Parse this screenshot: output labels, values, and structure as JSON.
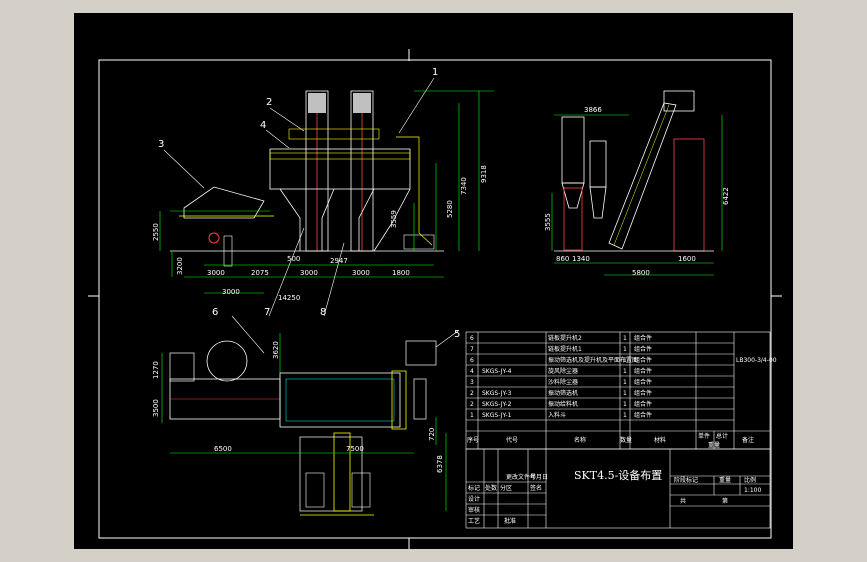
{
  "drawing": {
    "title": "SKT4.5-设备布置",
    "part_numbers": [
      "1",
      "2",
      "3",
      "4",
      "5",
      "6",
      "7",
      "8"
    ],
    "dims_elevation": [
      "3000",
      "2075",
      "500",
      "3000",
      "2947",
      "3000",
      "1800",
      "14250",
      "3000",
      "3200",
      "2550",
      "9318",
      "7340",
      "5280",
      "3559"
    ],
    "dims_side": [
      "3866",
      "6422",
      "3555",
      "860",
      "1340",
      "5800",
      "1600"
    ],
    "dims_plan": [
      "1270",
      "3500",
      "6500",
      "3620",
      "7500",
      "6378",
      "720"
    ]
  },
  "bom": {
    "rows": [
      {
        "no": "6",
        "code": "",
        "name": "链板提升机2",
        "qty": "1",
        "material": "组合件"
      },
      {
        "no": "7",
        "code": "",
        "name": "链板提升机1",
        "qty": "1",
        "material": "组合件"
      },
      {
        "no": "6",
        "code": "",
        "name": "振动筛选机及提升机及平面布置图",
        "qty": "1",
        "material": "组合件"
      },
      {
        "no": "4",
        "code": "SKGS-JY-4",
        "name": "旋风除尘器",
        "qty": "1",
        "material": "组合件"
      },
      {
        "no": "3",
        "code": "",
        "name": "沙料除尘器",
        "qty": "1",
        "material": "组合件"
      },
      {
        "no": "2",
        "code": "SKGS-JY-3",
        "name": "振动筛选机",
        "qty": "1",
        "material": "组合件"
      },
      {
        "no": "2",
        "code": "SKGS-JY-2",
        "name": "振动给料机",
        "qty": "1",
        "material": "组合件"
      },
      {
        "no": "1",
        "code": "SKGS-JY-1",
        "name": "入料斗",
        "qty": "1",
        "material": "组合件"
      }
    ],
    "header": {
      "no": "序号",
      "code": "代号",
      "name": "名称",
      "qty": "数量",
      "material": "材料",
      "unit_weight": "单件",
      "total_weight": "总计",
      "weight": "重量",
      "remark": "备注"
    },
    "side_code": "LB300-3/4-00"
  },
  "title_block": {
    "title": "SKT4.5-设备布置",
    "scale": "1:100",
    "stage_label": "阶段标记",
    "weight_label": "重量",
    "ratio_label": "比例",
    "sheet_label": "共",
    "page_label": "第",
    "marks": [
      "标记",
      "处数",
      "分区",
      "更改文件号",
      "签名",
      "年月日"
    ],
    "roles": [
      "设计",
      "审核",
      "工艺",
      "批准"
    ]
  }
}
